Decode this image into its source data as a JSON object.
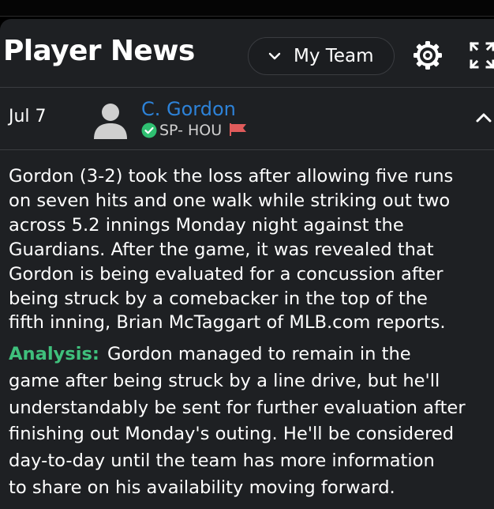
{
  "header": {
    "title": "Player News",
    "team_selector": "My Team",
    "icons": {
      "chevron": "chevron-down-icon",
      "settings": "gear-icon",
      "expand": "expand-icon"
    }
  },
  "news_item": {
    "date": "Jul 7",
    "player": {
      "name": "C. Gordon",
      "position_team": "SP- HOU",
      "status_icon": "check-circle-icon",
      "status_color": "#2fbf71",
      "flag_icon": "red-flag-icon",
      "flag_color": "#e05b5b",
      "avatar_icon": "person-silhouette-icon"
    },
    "news_lines": [
      "Gordon (3-2) took the loss after allowing five runs",
      "on seven hits and one walk while striking out two",
      "across 5.2 innings Monday night against the",
      "Guardians. After the game, it was revealed that",
      "Gordon is being evaluated for a concussion after",
      "being struck by a comebacker in the top of the",
      "fifth inning, Brian McTaggart of MLB.com reports."
    ],
    "analysis_label": "Analysis:",
    "analysis_lines": [
      "Gordon managed to remain in the",
      "game after being struck by a line drive, but he'll",
      "understandably be sent for further evaluation after",
      "finishing out Monday's outing. He'll be considered",
      "day-to-day until the team has more information",
      "to share on his availability moving forward."
    ]
  },
  "colors": {
    "background": "#1e2023",
    "link": "#2d82d8",
    "analysis": "#3fc07c",
    "text": "#ffffff"
  }
}
